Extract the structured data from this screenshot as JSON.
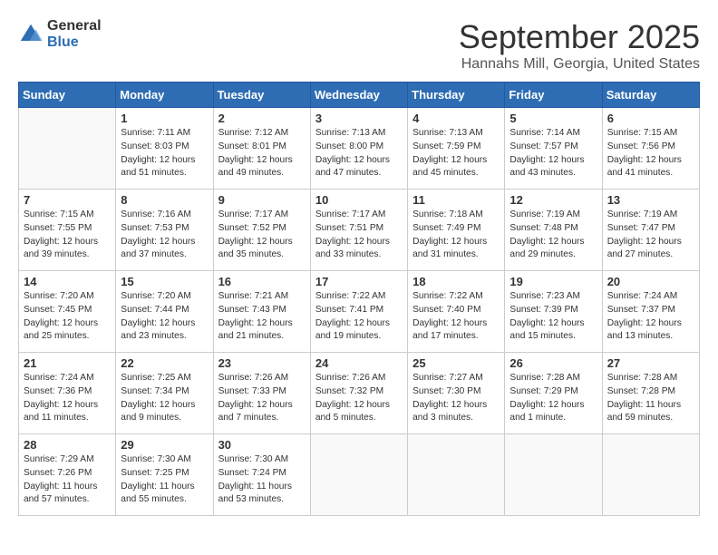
{
  "logo": {
    "general": "General",
    "blue": "Blue"
  },
  "header": {
    "month": "September 2025",
    "location": "Hannahs Mill, Georgia, United States"
  },
  "weekdays": [
    "Sunday",
    "Monday",
    "Tuesday",
    "Wednesday",
    "Thursday",
    "Friday",
    "Saturday"
  ],
  "weeks": [
    [
      {
        "day": "",
        "info": ""
      },
      {
        "day": "1",
        "info": "Sunrise: 7:11 AM\nSunset: 8:03 PM\nDaylight: 12 hours\nand 51 minutes."
      },
      {
        "day": "2",
        "info": "Sunrise: 7:12 AM\nSunset: 8:01 PM\nDaylight: 12 hours\nand 49 minutes."
      },
      {
        "day": "3",
        "info": "Sunrise: 7:13 AM\nSunset: 8:00 PM\nDaylight: 12 hours\nand 47 minutes."
      },
      {
        "day": "4",
        "info": "Sunrise: 7:13 AM\nSunset: 7:59 PM\nDaylight: 12 hours\nand 45 minutes."
      },
      {
        "day": "5",
        "info": "Sunrise: 7:14 AM\nSunset: 7:57 PM\nDaylight: 12 hours\nand 43 minutes."
      },
      {
        "day": "6",
        "info": "Sunrise: 7:15 AM\nSunset: 7:56 PM\nDaylight: 12 hours\nand 41 minutes."
      }
    ],
    [
      {
        "day": "7",
        "info": "Sunrise: 7:15 AM\nSunset: 7:55 PM\nDaylight: 12 hours\nand 39 minutes."
      },
      {
        "day": "8",
        "info": "Sunrise: 7:16 AM\nSunset: 7:53 PM\nDaylight: 12 hours\nand 37 minutes."
      },
      {
        "day": "9",
        "info": "Sunrise: 7:17 AM\nSunset: 7:52 PM\nDaylight: 12 hours\nand 35 minutes."
      },
      {
        "day": "10",
        "info": "Sunrise: 7:17 AM\nSunset: 7:51 PM\nDaylight: 12 hours\nand 33 minutes."
      },
      {
        "day": "11",
        "info": "Sunrise: 7:18 AM\nSunset: 7:49 PM\nDaylight: 12 hours\nand 31 minutes."
      },
      {
        "day": "12",
        "info": "Sunrise: 7:19 AM\nSunset: 7:48 PM\nDaylight: 12 hours\nand 29 minutes."
      },
      {
        "day": "13",
        "info": "Sunrise: 7:19 AM\nSunset: 7:47 PM\nDaylight: 12 hours\nand 27 minutes."
      }
    ],
    [
      {
        "day": "14",
        "info": "Sunrise: 7:20 AM\nSunset: 7:45 PM\nDaylight: 12 hours\nand 25 minutes."
      },
      {
        "day": "15",
        "info": "Sunrise: 7:20 AM\nSunset: 7:44 PM\nDaylight: 12 hours\nand 23 minutes."
      },
      {
        "day": "16",
        "info": "Sunrise: 7:21 AM\nSunset: 7:43 PM\nDaylight: 12 hours\nand 21 minutes."
      },
      {
        "day": "17",
        "info": "Sunrise: 7:22 AM\nSunset: 7:41 PM\nDaylight: 12 hours\nand 19 minutes."
      },
      {
        "day": "18",
        "info": "Sunrise: 7:22 AM\nSunset: 7:40 PM\nDaylight: 12 hours\nand 17 minutes."
      },
      {
        "day": "19",
        "info": "Sunrise: 7:23 AM\nSunset: 7:39 PM\nDaylight: 12 hours\nand 15 minutes."
      },
      {
        "day": "20",
        "info": "Sunrise: 7:24 AM\nSunset: 7:37 PM\nDaylight: 12 hours\nand 13 minutes."
      }
    ],
    [
      {
        "day": "21",
        "info": "Sunrise: 7:24 AM\nSunset: 7:36 PM\nDaylight: 12 hours\nand 11 minutes."
      },
      {
        "day": "22",
        "info": "Sunrise: 7:25 AM\nSunset: 7:34 PM\nDaylight: 12 hours\nand 9 minutes."
      },
      {
        "day": "23",
        "info": "Sunrise: 7:26 AM\nSunset: 7:33 PM\nDaylight: 12 hours\nand 7 minutes."
      },
      {
        "day": "24",
        "info": "Sunrise: 7:26 AM\nSunset: 7:32 PM\nDaylight: 12 hours\nand 5 minutes."
      },
      {
        "day": "25",
        "info": "Sunrise: 7:27 AM\nSunset: 7:30 PM\nDaylight: 12 hours\nand 3 minutes."
      },
      {
        "day": "26",
        "info": "Sunrise: 7:28 AM\nSunset: 7:29 PM\nDaylight: 12 hours\nand 1 minute."
      },
      {
        "day": "27",
        "info": "Sunrise: 7:28 AM\nSunset: 7:28 PM\nDaylight: 11 hours\nand 59 minutes."
      }
    ],
    [
      {
        "day": "28",
        "info": "Sunrise: 7:29 AM\nSunset: 7:26 PM\nDaylight: 11 hours\nand 57 minutes."
      },
      {
        "day": "29",
        "info": "Sunrise: 7:30 AM\nSunset: 7:25 PM\nDaylight: 11 hours\nand 55 minutes."
      },
      {
        "day": "30",
        "info": "Sunrise: 7:30 AM\nSunset: 7:24 PM\nDaylight: 11 hours\nand 53 minutes."
      },
      {
        "day": "",
        "info": ""
      },
      {
        "day": "",
        "info": ""
      },
      {
        "day": "",
        "info": ""
      },
      {
        "day": "",
        "info": ""
      }
    ]
  ]
}
